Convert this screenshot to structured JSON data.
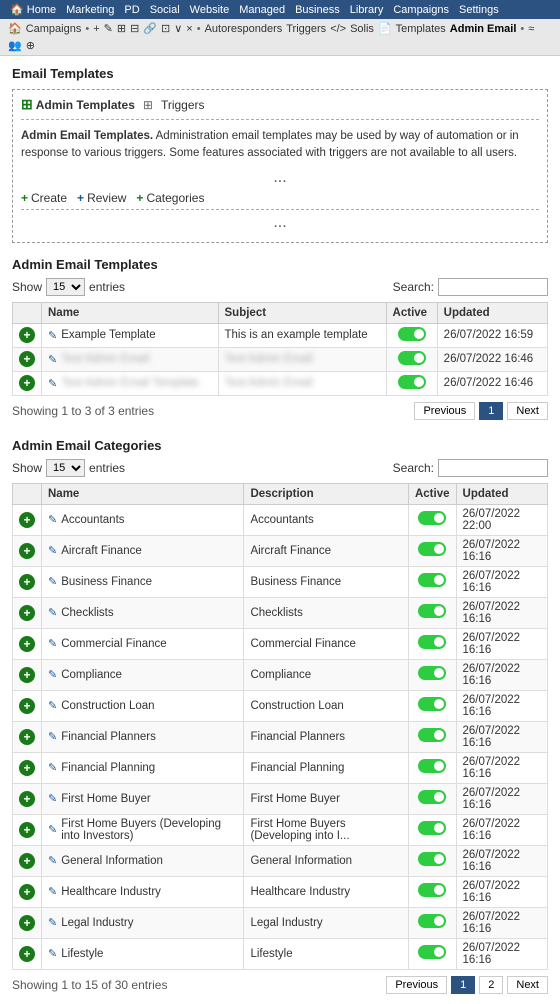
{
  "topnav": {
    "items": [
      "Home",
      "Marketing",
      "PD",
      "Social",
      "Website",
      "Managed",
      "Business",
      "Library",
      "Campaigns",
      "Settings"
    ]
  },
  "breadcrumb": {
    "home_icon": "🏠",
    "items": [
      "Campaigns",
      "•",
      "+",
      "✎",
      "⊞",
      "⊟",
      "🔗",
      "⊡",
      "∨",
      "×",
      "•",
      "Autoresponders",
      "Triggers",
      "</>",
      "Solis",
      "📄",
      "Templates",
      "Admin Email",
      "•",
      "≈",
      "👥",
      "⊕"
    ]
  },
  "email_templates": {
    "section_title": "Email Templates",
    "tabs": [
      {
        "label": "Admin Templates",
        "plus": true
      },
      {
        "label": "Triggers",
        "plus": true
      }
    ],
    "description_bold": "Admin Email Templates.",
    "description_text": " Administration email templates may be used by way of automation or in response to various triggers. Some features associated with triggers are not available to all users.",
    "ellipsis": "...",
    "actions": [
      {
        "label": "Create",
        "icon": "+"
      },
      {
        "label": "Review",
        "icon": "+"
      },
      {
        "label": "Categories",
        "icon": "+"
      }
    ]
  },
  "admin_email_templates": {
    "section_title": "Admin Email Templates",
    "show_label": "Show",
    "entries_label": "entries",
    "entries_value": "15",
    "search_label": "Search:",
    "search_placeholder": "",
    "columns": [
      "Name",
      "Subject",
      "Active",
      "Updated"
    ],
    "rows": [
      {
        "name": "Example Template",
        "subject": "This is an example template",
        "active": true,
        "updated": "26/07/2022 16:59",
        "blurred": false
      },
      {
        "name": "Test Admin Email",
        "subject": "Test Admin Email",
        "active": true,
        "updated": "26/07/2022 16:46",
        "blurred": true
      },
      {
        "name": "Test Admin Email Template",
        "subject": "Test Admin Email",
        "active": true,
        "updated": "26/07/2022 16:46",
        "blurred": true
      }
    ],
    "showing": "Showing 1 to 3 of 3 entries",
    "prev_label": "Previous",
    "next_label": "Next",
    "current_page": "1"
  },
  "admin_email_categories": {
    "section_title": "Admin Email Categories",
    "show_label": "Show",
    "entries_label": "entries",
    "entries_value": "15",
    "search_label": "Search:",
    "search_placeholder": "",
    "columns": [
      "Name",
      "Description",
      "Active",
      "Updated"
    ],
    "rows": [
      {
        "name": "Accountants",
        "description": "Accountants",
        "active": true,
        "updated": "26/07/2022 22:00"
      },
      {
        "name": "Aircraft Finance",
        "description": "Aircraft Finance",
        "active": true,
        "updated": "26/07/2022 16:16"
      },
      {
        "name": "Business Finance",
        "description": "Business Finance",
        "active": true,
        "updated": "26/07/2022 16:16"
      },
      {
        "name": "Checklists",
        "description": "Checklists",
        "active": true,
        "updated": "26/07/2022 16:16"
      },
      {
        "name": "Commercial Finance",
        "description": "Commercial Finance",
        "active": true,
        "updated": "26/07/2022 16:16"
      },
      {
        "name": "Compliance",
        "description": "Compliance",
        "active": true,
        "updated": "26/07/2022 16:16"
      },
      {
        "name": "Construction Loan",
        "description": "Construction Loan",
        "active": true,
        "updated": "26/07/2022 16:16"
      },
      {
        "name": "Financial Planners",
        "description": "Financial Planners",
        "active": true,
        "updated": "26/07/2022 16:16"
      },
      {
        "name": "Financial Planning",
        "description": "Financial Planning",
        "active": true,
        "updated": "26/07/2022 16:16"
      },
      {
        "name": "First Home Buyer",
        "description": "First Home Buyer",
        "active": true,
        "updated": "26/07/2022 16:16"
      },
      {
        "name": "First Home Buyers (Developing into Investors)",
        "description": "First Home Buyers (Developing into I...",
        "active": true,
        "updated": "26/07/2022 16:16"
      },
      {
        "name": "General Information",
        "description": "General Information",
        "active": true,
        "updated": "26/07/2022 16:16"
      },
      {
        "name": "Healthcare Industry",
        "description": "Healthcare Industry",
        "active": true,
        "updated": "26/07/2022 16:16"
      },
      {
        "name": "Legal Industry",
        "description": "Legal Industry",
        "active": true,
        "updated": "26/07/2022 16:16"
      },
      {
        "name": "Lifestyle",
        "description": "Lifestyle",
        "active": true,
        "updated": "26/07/2022 16:16"
      }
    ],
    "showing": "Showing 1 to 15 of 30 entries",
    "prev_label": "Previous",
    "next_label": "Next",
    "current_page": "1",
    "page2": "2"
  }
}
